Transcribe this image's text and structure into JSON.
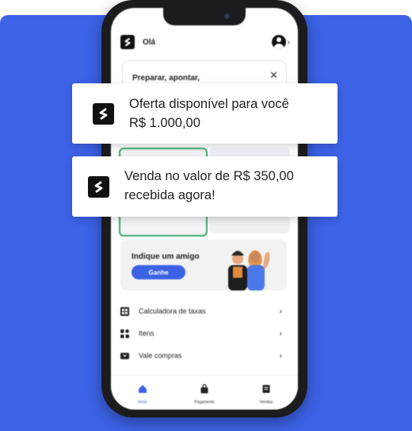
{
  "colors": {
    "accent": "#3c62e6",
    "card_border": "#3aa76d",
    "background_panel": "#3c62e6"
  },
  "header": {
    "greeting": "Olá",
    "logo_icon": "s-logo-icon",
    "avatar_icon": "user-icon"
  },
  "tip_card": {
    "text": "Preparar, apontar,",
    "close_icon": "close-icon"
  },
  "invite": {
    "title": "Indique um amigo",
    "button_label": "Ganhe"
  },
  "menu": {
    "items": [
      {
        "label": "Calculadora de taxas",
        "icon": "calculator-icon"
      },
      {
        "label": "Itens",
        "icon": "grid-icon"
      },
      {
        "label": "Vale compras",
        "icon": "gift-card-icon"
      }
    ]
  },
  "tabbar": {
    "tabs": [
      {
        "label": "Início",
        "icon": "home-icon",
        "active": true
      },
      {
        "label": "Pagamento",
        "icon": "bag-icon",
        "active": false
      },
      {
        "label": "Vendas",
        "icon": "receipt-icon",
        "active": false
      }
    ]
  },
  "notifications": [
    {
      "line1": "Oferta disponível para você",
      "line2": "R$ 1.000,00"
    },
    {
      "line1": "Venda no valor de R$ 350,00",
      "line2": "recebida agora!"
    }
  ]
}
